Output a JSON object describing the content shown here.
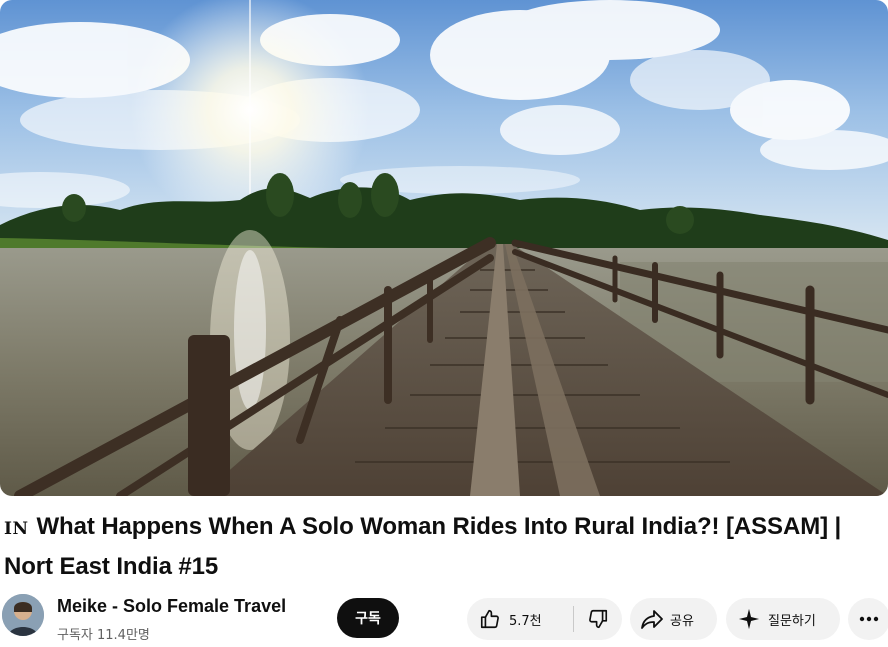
{
  "video": {
    "title_flag": "IN",
    "title": "What Happens When A Solo Woman Rides Into Rural India?! [ASSAM] | Nort East India #15"
  },
  "channel": {
    "name": "Meike - Solo Female Travel",
    "subscribers": "구독자 11.4만명",
    "subscribe_label": "구독"
  },
  "actions": {
    "like_count": "5.7천",
    "share_label": "공유",
    "ask_label": "질문하기"
  },
  "icons": {
    "like": "thumbs-up-icon",
    "dislike": "thumbs-down-icon",
    "share": "share-arrow-icon",
    "ask": "sparkle-icon",
    "more": "more-horizontal-icon"
  }
}
